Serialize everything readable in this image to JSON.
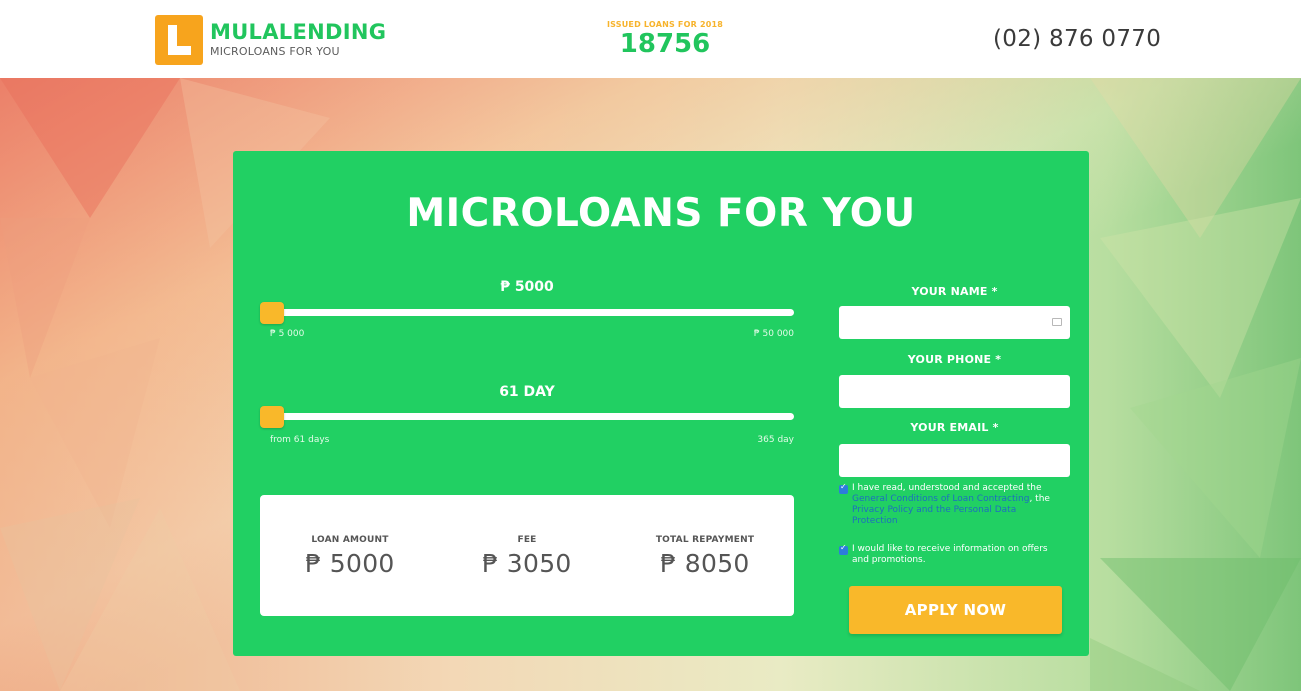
{
  "header": {
    "brand": "MULALENDING",
    "tagline": "MICROLOANS FOR YOU",
    "issued_label": "ISSUED LOANS FOR 2018",
    "issued_count": "18756",
    "phone": "(02) 876 0770"
  },
  "card": {
    "title": "MICROLOANS FOR YOU",
    "amount_slider": {
      "value_label": "₱ 5000",
      "min_label": "₱ 5 000",
      "max_label": "₱ 50 000",
      "value_fraction": 0.0
    },
    "days_slider": {
      "value_label": "61 DAY",
      "min_label": "from 61 days",
      "max_label": "365 day",
      "value_fraction": 0.0
    },
    "summary": {
      "loan_amount_label": "LOAN AMOUNT",
      "loan_amount_value": "₱ 5000",
      "fee_label": "FEE",
      "fee_value": "₱ 3050",
      "total_label": "TOTAL REPAYMENT",
      "total_value": "₱ 8050"
    },
    "form": {
      "name_label": "YOUR NAME *",
      "phone_label": "YOUR PHONE *",
      "email_label": "YOUR EMAIL *",
      "consent_prefix": "I have read, understood and accepted the ",
      "consent_link1": "General Conditions of Loan Contracting",
      "consent_mid": ", the ",
      "consent_link2": "Privacy Policy and the Personal Data Protection",
      "promo_text": "I would like to receive information on offers and promotions.",
      "apply_label": "APPLY NOW"
    }
  },
  "colors": {
    "brand_green": "#21d063",
    "accent_orange": "#f9b82a",
    "link_blue": "#1e6fbf"
  }
}
